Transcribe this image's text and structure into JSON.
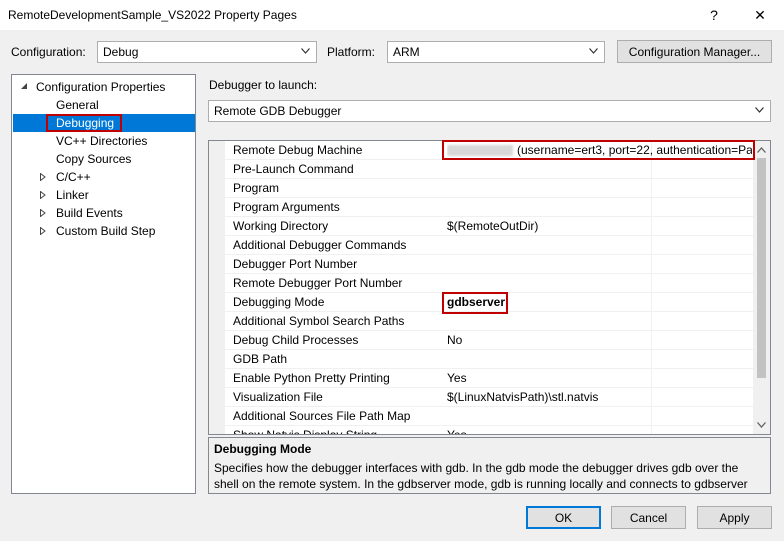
{
  "window": {
    "title": "RemoteDevelopmentSample_VS2022 Property Pages",
    "help_glyph": "?",
    "close_glyph": "✕"
  },
  "config_bar": {
    "configuration_label": "Configuration:",
    "configuration_value": "Debug",
    "platform_label": "Platform:",
    "platform_value": "ARM",
    "manager_button": "Configuration Manager..."
  },
  "tree": {
    "root": "Configuration Properties",
    "items": [
      "General",
      "Debugging",
      "VC++ Directories",
      "Copy Sources",
      "C/C++",
      "Linker",
      "Build Events",
      "Custom Build Step"
    ],
    "selected": "Debugging"
  },
  "debugger": {
    "label": "Debugger to launch:",
    "value": "Remote GDB Debugger"
  },
  "properties": [
    {
      "name": "Remote Debug Machine",
      "value": "(username=ert3, port=22, authentication=Pa"
    },
    {
      "name": "Pre-Launch Command",
      "value": ""
    },
    {
      "name": "Program",
      "value": ""
    },
    {
      "name": "Program Arguments",
      "value": ""
    },
    {
      "name": "Working Directory",
      "value": "$(RemoteOutDir)"
    },
    {
      "name": "Additional Debugger Commands",
      "value": ""
    },
    {
      "name": "Debugger Port Number",
      "value": ""
    },
    {
      "name": "Remote Debugger Port Number",
      "value": ""
    },
    {
      "name": "Debugging Mode",
      "value": "gdbserver"
    },
    {
      "name": "Additional Symbol Search Paths",
      "value": ""
    },
    {
      "name": "Debug Child Processes",
      "value": "No"
    },
    {
      "name": "GDB Path",
      "value": ""
    },
    {
      "name": "Enable Python Pretty Printing",
      "value": "Yes"
    },
    {
      "name": "Visualization File",
      "value": "$(LinuxNatvisPath)\\stl.natvis"
    },
    {
      "name": "Additional Sources File Path Map",
      "value": ""
    },
    {
      "name": "Show Natvis Display String",
      "value": "Yes"
    }
  ],
  "description": {
    "title": "Debugging Mode",
    "text": "Specifies how the debugger interfaces with gdb. In the gdb mode the debugger drives gdb over the shell on the remote system. In the gdbserver mode, gdb is running locally and connects to gdbserver runnin..."
  },
  "buttons": {
    "ok": "OK",
    "cancel": "Cancel",
    "apply": "Apply"
  }
}
